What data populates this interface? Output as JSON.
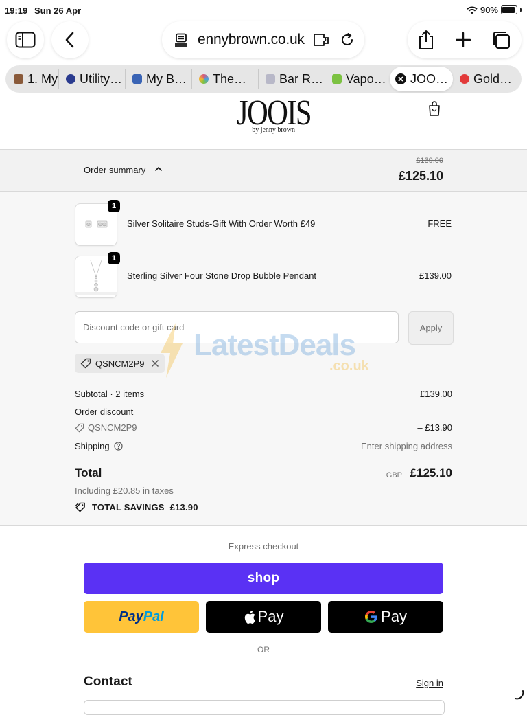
{
  "status_bar": {
    "time": "19:19",
    "date": "Sun 26 Apr",
    "battery": "90%"
  },
  "browser": {
    "url": "ennybrown.co.uk",
    "tabs": [
      {
        "label": "1. My",
        "fav_color": "#8a5a3a"
      },
      {
        "label": "Utility…",
        "fav_color": "#2a3b8f"
      },
      {
        "label": "My B…",
        "fav_color": "#3a64b5"
      },
      {
        "label": "The…",
        "fav_color": "#d9577b"
      },
      {
        "label": "Bar R…",
        "fav_color": "#b8b8c8"
      },
      {
        "label": "Vapo…",
        "fav_color": "#7cc242"
      },
      {
        "label": "JOO…",
        "fav_color": "#111111"
      },
      {
        "label": "Gold…",
        "fav_color": "#e23a3a"
      }
    ]
  },
  "store": {
    "logo": "JOOIS",
    "logo_sub": "by jenny brown"
  },
  "order_summary": {
    "label": "Order summary",
    "original_total": "£139.00",
    "total": "£125.10"
  },
  "items": [
    {
      "name": "Silver Solitaire Studs-Gift With Order Worth £49",
      "price": "FREE",
      "qty": "1"
    },
    {
      "name": "Sterling Silver Four Stone Drop Bubble Pendant",
      "price": "£139.00",
      "qty": "1"
    }
  ],
  "discount": {
    "placeholder": "Discount code or gift card",
    "apply_label": "Apply",
    "applied_code": "QSNCM2P9"
  },
  "watermark": {
    "text": "LatestDeals",
    "suffix": ".co.uk"
  },
  "totals": {
    "subtotal_label": "Subtotal · 2 items",
    "subtotal_value": "£139.00",
    "order_discount_label": "Order discount",
    "discount_code": "QSNCM2P9",
    "discount_value": "– £13.90",
    "shipping_label": "Shipping",
    "shipping_value": "Enter shipping address",
    "total_label": "Total",
    "currency": "GBP",
    "total_value": "£125.10",
    "tax_note": "Including £20.85 in taxes",
    "savings_label": "TOTAL SAVINGS",
    "savings_value": "£13.90"
  },
  "express": {
    "label": "Express checkout",
    "shop": "shop",
    "paypal_a": "Pay",
    "paypal_b": "Pal",
    "apple_pay": "Pay",
    "google_pay": "Pay",
    "or": "OR"
  },
  "contact": {
    "title": "Contact",
    "sign_in": "Sign in"
  },
  "colors": {
    "shop_purple": "#5a31f4",
    "paypal_yellow": "#ffc439"
  }
}
